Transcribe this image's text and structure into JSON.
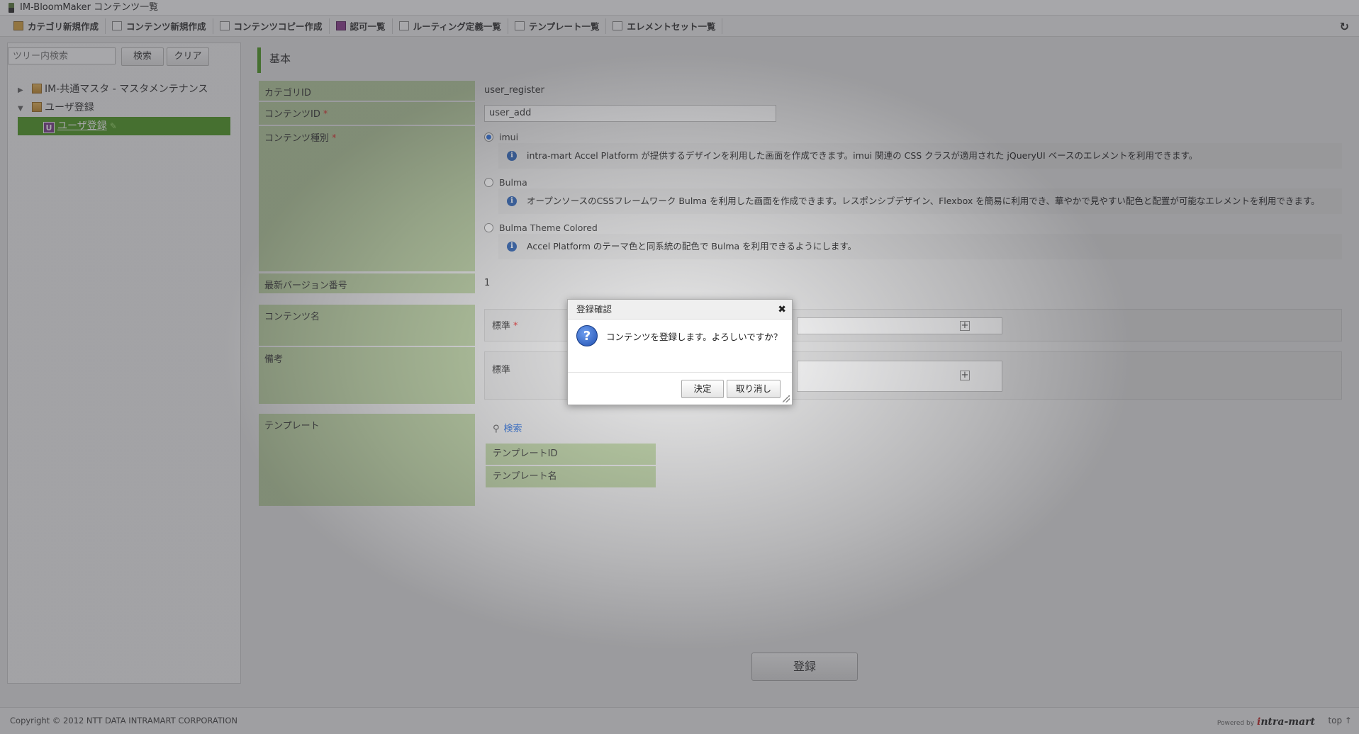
{
  "window": {
    "title": "IM-BloomMaker コンテンツ一覧"
  },
  "toolbar": {
    "items": [
      {
        "label": "カテゴリ新規作成",
        "icon": "category-add-icon"
      },
      {
        "label": "コンテンツ新規作成",
        "icon": "content-add-icon"
      },
      {
        "label": "コンテンツコピー作成",
        "icon": "content-copy-icon"
      },
      {
        "label": "認可一覧",
        "icon": "authorization-icon"
      },
      {
        "label": "ルーティング定義一覧",
        "icon": "routing-icon"
      },
      {
        "label": "テンプレート一覧",
        "icon": "template-icon"
      },
      {
        "label": "エレメントセット一覧",
        "icon": "element-set-icon"
      }
    ],
    "refresh_icon": "refresh-icon"
  },
  "sidebar": {
    "search_placeholder": "ツリー内検索",
    "search_button": "検索",
    "clear_button": "クリア",
    "tree": [
      {
        "label": "IM-共通マスタ - マスタメンテナンス",
        "expanded": false
      },
      {
        "label": "ユーザ登録",
        "expanded": true
      },
      {
        "label": "ユーザ登録",
        "badge": "U",
        "selected": true
      }
    ]
  },
  "main": {
    "section_title": "基本",
    "category_id_label": "カテゴリID",
    "category_id_value": "user_register",
    "content_id_label": "コンテンツID",
    "content_id_value": "user_add",
    "required_mark": "*",
    "content_type_label": "コンテンツ種別",
    "content_types": [
      {
        "label": "imui",
        "selected": true,
        "desc": "intra-mart Accel Platform が提供するデザインを利用した画面を作成できます。imui 関連の CSS クラスが適用された jQueryUI ベースのエレメントを利用できます。"
      },
      {
        "label": "Bulma",
        "selected": false,
        "desc": "オープンソースのCSSフレームワーク Bulma を利用した画面を作成できます。レスポンシブデザイン、Flexbox を簡易に利用でき、華やかで見やすい配色と配置が可能なエレメントを利用できます。"
      },
      {
        "label": "Bulma Theme Colored",
        "selected": false,
        "desc": "Accel Platform のテーマ色と同系統の配色で Bulma を利用できるようにします。"
      }
    ],
    "version_label": "最新バージョン番号",
    "version_value": "1",
    "content_name_label": "コンテンツ名",
    "content_name_sub": "標準",
    "remarks_label": "備考",
    "remarks_sub": "標準",
    "template_label": "テンプレート",
    "template_search": "検索",
    "template_id_label": "テンプレートID",
    "template_name_label": "テンプレート名",
    "submit_label": "登録"
  },
  "footer": {
    "copyright": "Copyright © 2012 NTT DATA INTRAMART CORPORATION",
    "powered_by": "Powered by",
    "brand": "intra-mart",
    "top_link": "top ↑"
  },
  "dialog": {
    "title": "登録確認",
    "message": "コンテンツを登録します。よろしいですか？",
    "ok_label": "決定",
    "cancel_label": "取り消し",
    "icon": "question-icon"
  }
}
